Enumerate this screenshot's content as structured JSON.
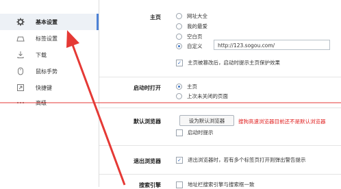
{
  "sidebar": {
    "items": [
      {
        "label": "基本设置",
        "icon": "gear-icon",
        "active": true
      },
      {
        "label": "标签设置",
        "icon": "tab-icon"
      },
      {
        "label": "下载",
        "icon": "download-icon"
      },
      {
        "label": "鼠标手势",
        "icon": "mouse-icon"
      },
      {
        "label": "快捷键",
        "icon": "shortcut-icon"
      },
      {
        "label": "高级",
        "icon": "more-icon"
      }
    ]
  },
  "homepage": {
    "label": "主页",
    "options": [
      "网址大全",
      "我的最爱",
      "空白页",
      "自定义"
    ],
    "selected": "自定义",
    "custom_url": "http://123.sogou.com/",
    "protect_label": "主页被篡改后，启动时提示主页保护效果",
    "protect_checked": true
  },
  "startup": {
    "label": "启动时打开",
    "options": [
      "主页",
      "上次未关闭的页面"
    ],
    "selected": "主页"
  },
  "default_browser": {
    "label": "默认浏览器",
    "button": "设为默认浏览器",
    "warning": "搜狗高速浏览器目前还不是默认浏览器",
    "startup_check_label": "启动时提示",
    "startup_check_checked": false
  },
  "exit_browser": {
    "label": "退出浏览器",
    "option_label": "退出浏览器时，若有多个标签页打开则弹出警告提示",
    "checked": true
  },
  "search_engine": {
    "label": "搜索引擎",
    "option_label": "地址栏搜索引擎与搜索框一致",
    "checked": false
  },
  "colors": {
    "accent": "#3b73c6",
    "annotation_red": "#e53935",
    "warning_red": "#e02020"
  }
}
